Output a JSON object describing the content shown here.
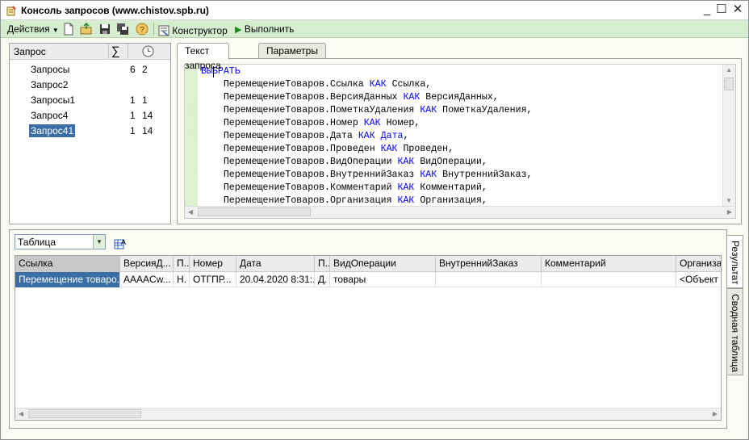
{
  "window": {
    "title": "Консоль запросов (www.chistov.spb.ru)",
    "minimize": "_",
    "maximize": "☐",
    "close": "✕"
  },
  "toolbar": {
    "actions_label": "Действия",
    "designer_label": "Конструктор",
    "execute_label": "Выполнить"
  },
  "query_tree": {
    "header": "Запрос",
    "sum_header": "∑",
    "rows": [
      {
        "name": "Запросы",
        "c1": "6",
        "c2": "2"
      },
      {
        "name": "Запрос2",
        "c1": "",
        "c2": ""
      },
      {
        "name": "Запросы1",
        "c1": "1",
        "c2": "1"
      },
      {
        "name": "Запрос4",
        "c1": "1",
        "c2": "14"
      },
      {
        "name": "Запрос41",
        "c1": "1",
        "c2": "14",
        "selected": true
      }
    ]
  },
  "tabs": {
    "query_text": "Текст запроса",
    "parameters": "Параметры"
  },
  "query": {
    "lines": [
      [
        {
          "t": "ВЫБРАТЬ",
          "kw": true
        }
      ],
      [
        {
          "t": "    ПеремещениеТоваров.Ссылка "
        },
        {
          "t": "КАК",
          "kw": true
        },
        {
          "t": " Ссылка,"
        }
      ],
      [
        {
          "t": "    ПеремещениеТоваров.ВерсияДанных "
        },
        {
          "t": "КАК",
          "kw": true
        },
        {
          "t": " ВерсияДанных,"
        }
      ],
      [
        {
          "t": "    ПеремещениеТоваров.ПометкаУдаления "
        },
        {
          "t": "КАК",
          "kw": true
        },
        {
          "t": " ПометкаУдаления,"
        }
      ],
      [
        {
          "t": "    ПеремещениеТоваров.Номер "
        },
        {
          "t": "КАК",
          "kw": true
        },
        {
          "t": " Номер,"
        }
      ],
      [
        {
          "t": "    ПеремещениеТоваров.Дата "
        },
        {
          "t": "КАК",
          "kw": true
        },
        {
          "t": " "
        },
        {
          "t": "Дата",
          "kw": true
        },
        {
          "t": ","
        }
      ],
      [
        {
          "t": "    ПеремещениеТоваров.Проведен "
        },
        {
          "t": "КАК",
          "kw": true
        },
        {
          "t": " Проведен,"
        }
      ],
      [
        {
          "t": "    ПеремещениеТоваров.ВидОперации "
        },
        {
          "t": "КАК",
          "kw": true
        },
        {
          "t": " ВидОперации,"
        }
      ],
      [
        {
          "t": "    ПеремещениеТоваров.ВнутреннийЗаказ "
        },
        {
          "t": "КАК",
          "kw": true
        },
        {
          "t": " ВнутреннийЗаказ,"
        }
      ],
      [
        {
          "t": "    ПеремещениеТоваров.Комментарий "
        },
        {
          "t": "КАК",
          "kw": true
        },
        {
          "t": " Комментарий,"
        }
      ],
      [
        {
          "t": "    ПеремещениеТоваров.Организация "
        },
        {
          "t": "КАК",
          "kw": true
        },
        {
          "t": " Организация,"
        }
      ]
    ]
  },
  "result": {
    "view_mode": "Таблица",
    "columns": [
      "Ссылка",
      "ВерсияД...",
      "П...",
      "Номер",
      "Дата",
      "П...",
      "ВидОперации",
      "ВнутреннийЗаказ",
      "Комментарий",
      "Организа"
    ],
    "rows": [
      [
        "Перемещение товаро...",
        "AAAACw...",
        "Н.",
        "ОТГПР...",
        "20.04.2020 8:31:...",
        "Д.",
        "товары",
        "",
        "",
        "<Объект"
      ]
    ]
  },
  "side_tabs": {
    "result": "Результат",
    "pivot": "Сводная таблица"
  }
}
